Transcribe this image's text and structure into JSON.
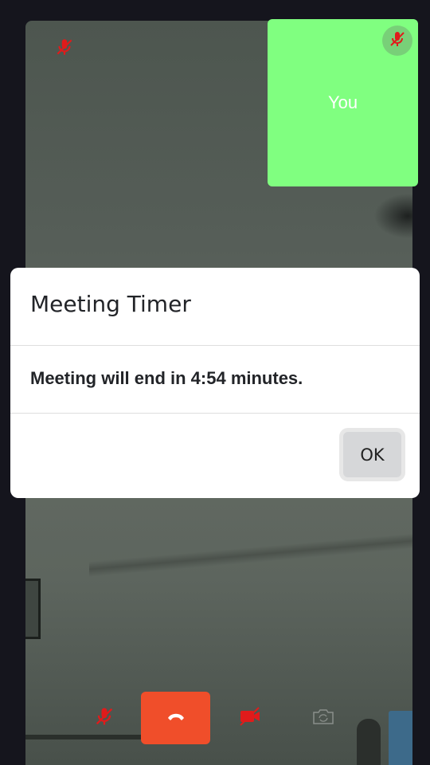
{
  "remote": {
    "mic_icon": "mic-off-icon",
    "mute_color": "#e01b1b"
  },
  "self_view": {
    "label": "You",
    "background": "#80ff80",
    "mic_icon": "mic-off-icon"
  },
  "dialog": {
    "title": "Meeting Timer",
    "message": "Meeting will end in 4:54 minutes.",
    "ok_label": "OK"
  },
  "controls": {
    "mic": "mic-off-icon",
    "end_call": "phone-hangup-icon",
    "end_call_color": "#f04e2a",
    "video": "video-off-icon",
    "switch_camera": "camera-switch-icon"
  }
}
